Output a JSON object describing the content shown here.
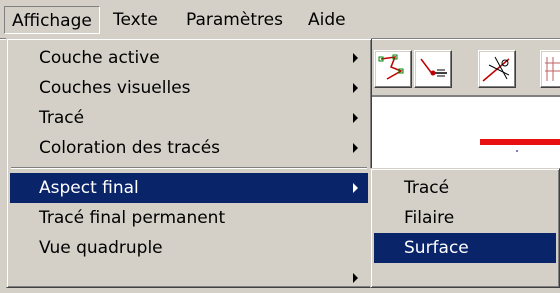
{
  "menubar": {
    "items": [
      {
        "label": "Affichage"
      },
      {
        "label": "Texte"
      },
      {
        "label": "Paramètres"
      },
      {
        "label": "Aide"
      }
    ]
  },
  "affichage_menu": {
    "items": [
      {
        "label": "Couche active",
        "has_submenu": true
      },
      {
        "label": "Couches visuelles",
        "has_submenu": true
      },
      {
        "label": "Tracé",
        "has_submenu": true
      },
      {
        "label": "Coloration des tracés",
        "has_submenu": true
      },
      {
        "label": "Aspect final",
        "has_submenu": true,
        "highlighted": true
      },
      {
        "label": "Tracé final permanent",
        "has_submenu": false
      },
      {
        "label": "Vue quadruple",
        "has_submenu": false
      }
    ]
  },
  "aspect_final_submenu": {
    "items": [
      {
        "label": "Tracé"
      },
      {
        "label": "Filaire"
      },
      {
        "label": "Surface",
        "highlighted": true
      }
    ]
  },
  "toolbar": {
    "icons": [
      "curve-tool-icon",
      "point-line-tool-icon",
      "cut-tool-icon",
      "grid-tool-icon"
    ]
  },
  "colors": {
    "highlight": "#0a246a",
    "face": "#d4d0c8",
    "canvas": "#ffffff",
    "trace_line": "#e81010"
  }
}
